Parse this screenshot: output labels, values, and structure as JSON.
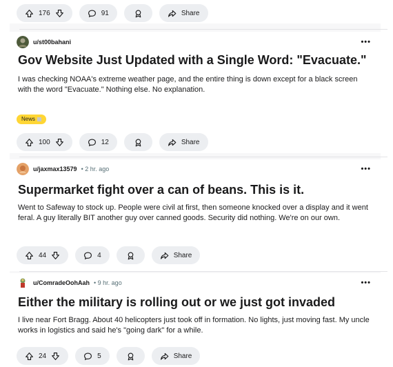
{
  "top_partial": {
    "score": "176",
    "comments": "91",
    "share": "Share"
  },
  "posts": [
    {
      "user": "u/st00bahani",
      "title": "Gov Website Just Updated with a Single Word: \"Evacuate.\"",
      "body": "I was checking NOAA's extreme weather page, and the entire thing is down except for a black screen with the word \"Evacuate.\" Nothing else. No explanation.",
      "flair": "News",
      "score": "100",
      "comments": "12",
      "share": "Share"
    },
    {
      "user": "u/jaxmax13579",
      "time": "• 2 hr. ago",
      "title": "Supermarket fight over a can of beans. This is it.",
      "body": "Went to Safeway to stock up. People were civil at first, then someone knocked over a display and it went feral. A guy literally BIT another guy over canned goods. Security did nothing. We're on our own.",
      "score": "44",
      "comments": "4",
      "share": "Share"
    },
    {
      "user": "u/ComradeOohAah",
      "time": "• 9 hr. ago",
      "title": "Either the military is rolling out or we just got invaded",
      "body": "I live near Fort Bragg. About 40 helicopters just took off in formation. No lights, just moving fast. My uncle works in logistics and said he's \"going dark\" for a while.",
      "score": "24",
      "comments": "5",
      "share": "Share"
    }
  ],
  "more_label": "•••"
}
